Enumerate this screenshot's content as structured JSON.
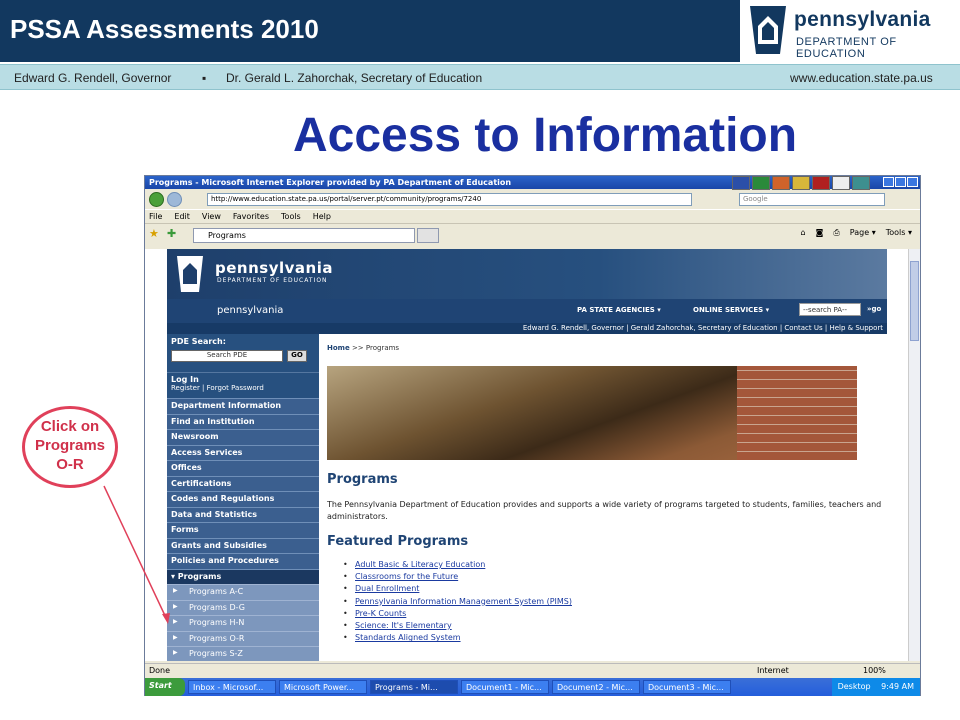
{
  "slide": {
    "title": "PSSA Assessments 2010",
    "logo_main": "pennsylvania",
    "logo_sub": "DEPARTMENT OF EDUCATION",
    "governor": "Edward G. Rendell, Governor",
    "bullet": "▪",
    "secretary": "Dr. Gerald L. Zahorchak, Secretary of Education",
    "website": "www.education.state.pa.us",
    "heading": "Access to Information",
    "callout": "Click on Programs O-R"
  },
  "browser": {
    "window_title": "Programs - Microsoft Internet Explorer provided by PA Department of Education",
    "address": "http://www.education.state.pa.us/portal/server.pt/community/programs/7240",
    "search_placeholder": "Google",
    "menu": [
      "File",
      "Edit",
      "View",
      "Favorites",
      "Tools",
      "Help"
    ],
    "tab_label": "Programs",
    "commands": [
      "Page ▾",
      "Tools ▾"
    ],
    "status_left": "Done",
    "status_zone": "Internet",
    "status_zoom": "100%"
  },
  "site": {
    "logo_main": "pennsylvania",
    "logo_sub": "DEPARTMENT OF EDUCATION",
    "pa_brand": "pennsylvania",
    "nav_agencies": "PA STATE AGENCIES ▾",
    "nav_online": "ONLINE SERVICES ▾",
    "nav_search": "--search PA--",
    "nav_go": "»go",
    "info_bar": "Edward G. Rendell, Governor | Gerald Zahorchak, Secretary of Education | Contact Us | Help & Support",
    "pde_search_label": "PDE Search:",
    "pde_search_placeholder": "Search PDE",
    "pde_go": "GO",
    "login": "Log In",
    "login_sub": "Register | Forgot Password",
    "nav": [
      "Department Information",
      "Find an Institution",
      "Newsroom",
      "Access Services",
      "Offices",
      "Certifications",
      "Codes and Regulations",
      "Data and Statistics",
      "Forms",
      "Grants and Subsidies",
      "Policies and Procedures"
    ],
    "programs_active": "▾ Programs",
    "programs_sub": [
      "Programs A-C",
      "Programs D-G",
      "Programs H-N",
      "Programs O-R",
      "Programs S-Z"
    ],
    "breadcrumb_home": "Home",
    "breadcrumb_rest": " >> Programs",
    "page_title": "Programs",
    "description": "The Pennsylvania Department of Education provides and supports a wide variety of programs targeted to students, families, teachers and administrators.",
    "featured_title": "Featured Programs",
    "featured": [
      "Adult Basic & Literacy Education",
      "Classrooms for the Future",
      "Dual Enrollment",
      "Pennsylvania Information Management System (PIMS)",
      "Pre-K Counts",
      "Science: It's Elementary",
      "Standards Aligned System"
    ]
  },
  "taskbar": {
    "start": "Start",
    "tasks": [
      "Inbox - Microsof...",
      "Microsoft Power...",
      "Programs - Mi...",
      "Document1 - Mic...",
      "Document2 - Mic...",
      "Document3 - Mic..."
    ],
    "desktop": "Desktop",
    "clock": "9:49 AM"
  }
}
